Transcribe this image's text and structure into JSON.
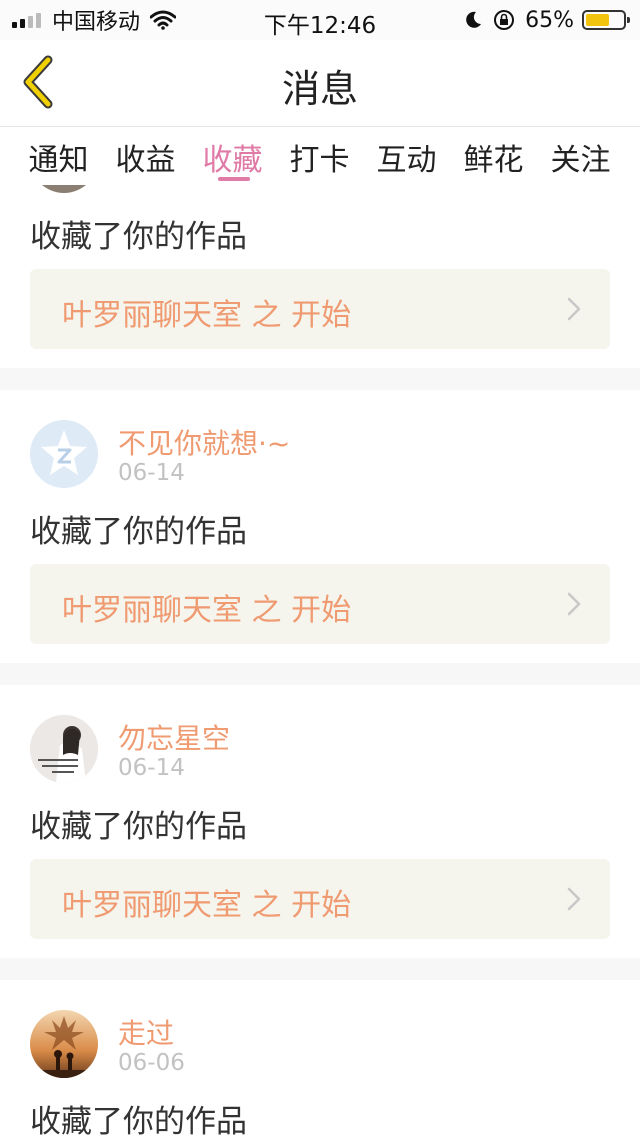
{
  "status_bar": {
    "carrier": "中国移动",
    "time": "下午12:46",
    "battery_percent": "65%",
    "battery_level": 0.65
  },
  "nav": {
    "title": "消息"
  },
  "tabs": [
    {
      "label": "通知"
    },
    {
      "label": "收益"
    },
    {
      "label": "收藏",
      "active": true
    },
    {
      "label": "打卡"
    },
    {
      "label": "互动"
    },
    {
      "label": "鲜花"
    },
    {
      "label": "关注"
    }
  ],
  "items": [
    {
      "user": "",
      "date": "",
      "action": "收藏了你的作品",
      "work": "叶罗丽聊天室 之 开始",
      "avatar": "partial-avatar"
    },
    {
      "user": "不见你就想·~",
      "date": "06-14",
      "action": "收藏了你的作品",
      "work": "叶罗丽聊天室 之 开始",
      "avatar": "qzone-star-avatar"
    },
    {
      "user": "勿忘星空",
      "date": "06-14",
      "action": "收藏了你的作品",
      "work": "叶罗丽聊天室 之 开始",
      "avatar": "girl-photo-avatar"
    },
    {
      "user": "走过",
      "date": "06-06",
      "action": "收藏了你的作品",
      "work": "",
      "avatar": "sunset-photo-avatar"
    }
  ],
  "colors": {
    "accent_pink": "#e07aa6",
    "name_orange": "#ef9a70",
    "work_bg": "#f5f5ee",
    "battery_yellow": "#f2c40f",
    "back_arrow": "#f0d000"
  }
}
